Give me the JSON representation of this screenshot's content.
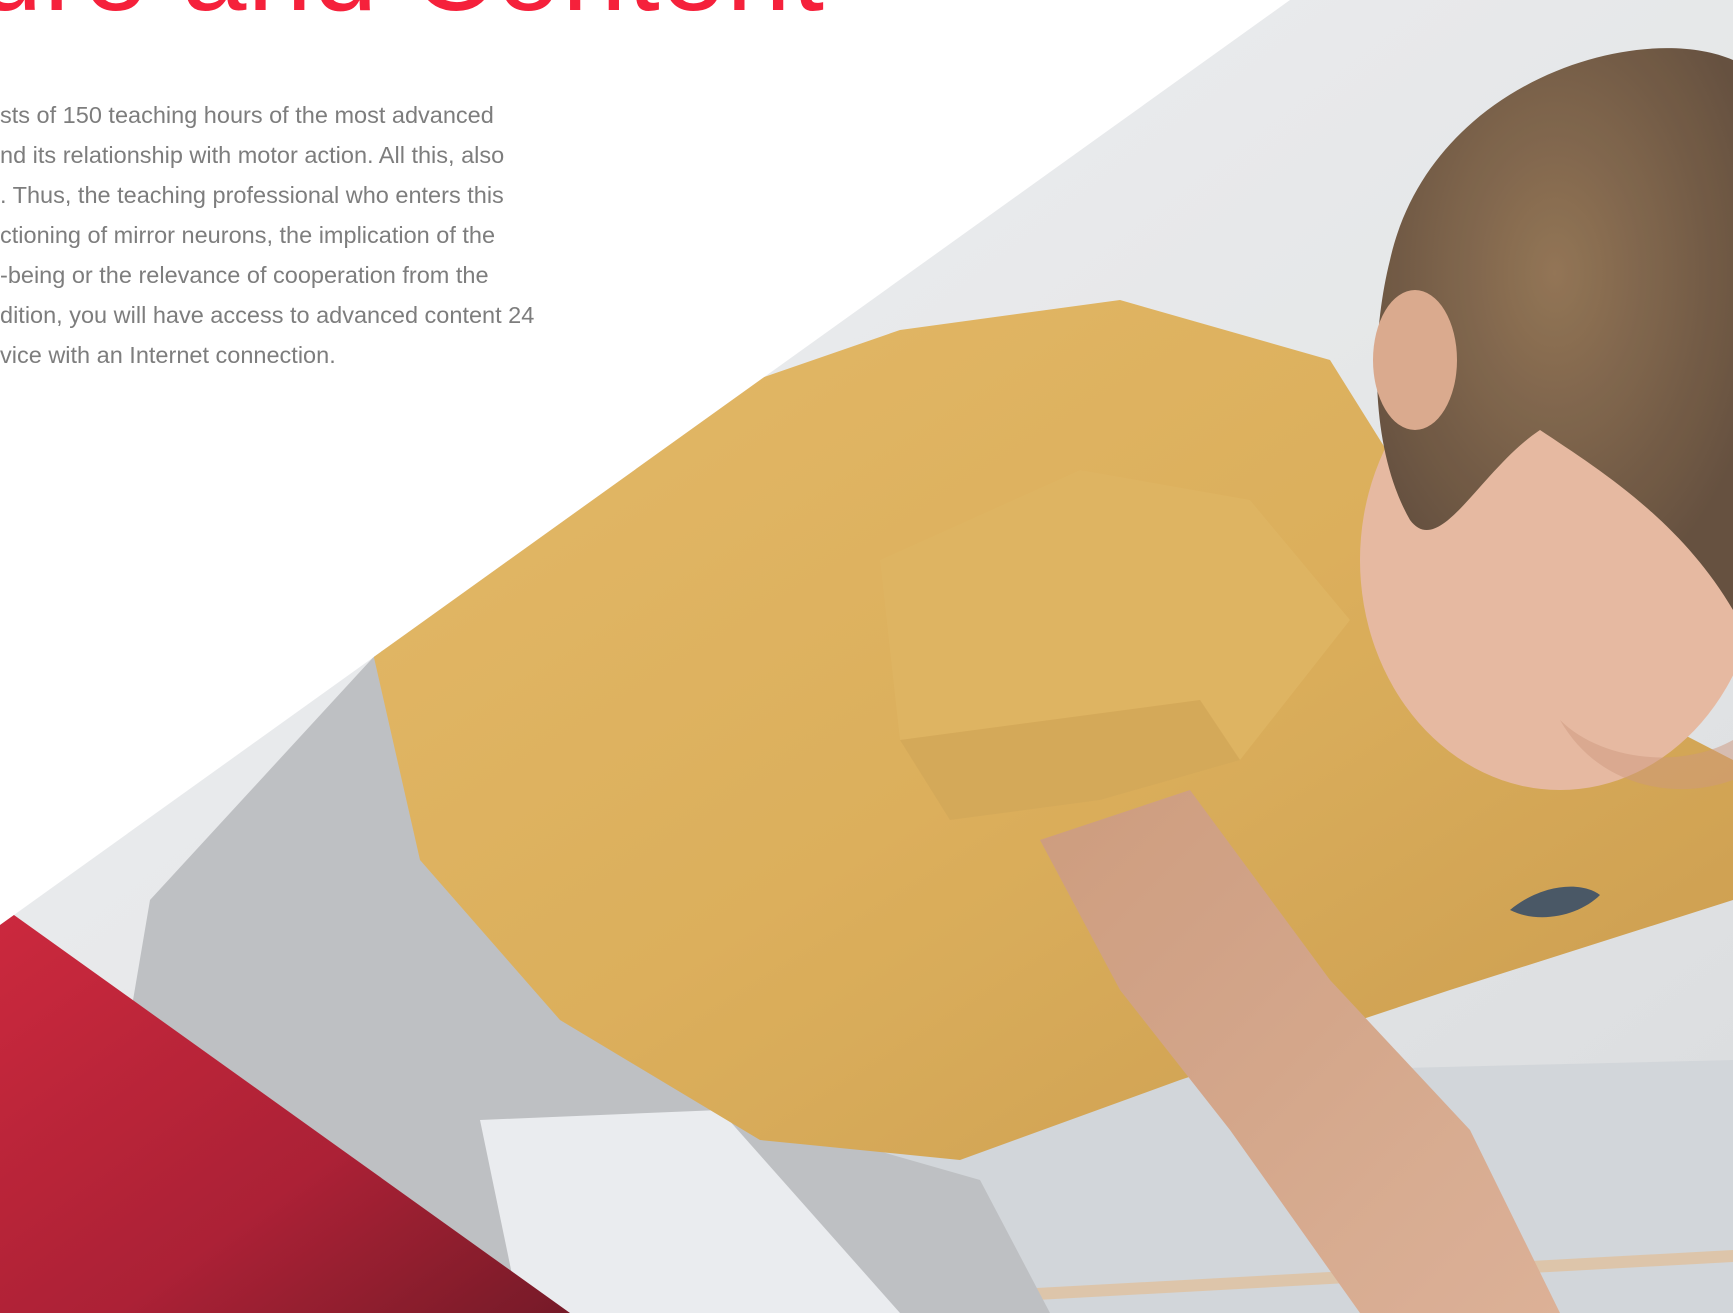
{
  "section": {
    "title": "ure and Content",
    "description_lines": [
      "sts of 150 teaching hours of the most advanced",
      "nd its relationship with motor action. All this, also",
      ". Thus, the teaching professional who enters this",
      "ctioning of mirror neurons, the implication of the",
      "-being or the relevance of cooperation from the",
      "dition, you will have access to advanced content 24",
      "vice with an Internet connection."
    ]
  },
  "colors": {
    "accent": "#f5213b",
    "text_muted": "#7d7d7d",
    "accent_dark": "#b0102a"
  }
}
